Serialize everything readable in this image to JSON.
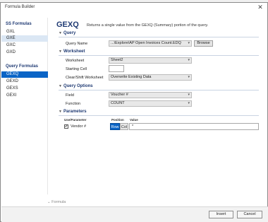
{
  "window": {
    "title": "Formula Builder",
    "close_glyph": "✕"
  },
  "sidebar": {
    "groups": [
      {
        "label": "SS Formulas",
        "items": [
          "GXL",
          "GXE",
          "GXC",
          "GXD"
        ]
      },
      {
        "label": "Query Formulas",
        "items": [
          "GEXQ",
          "GEXD",
          "GEXS",
          "GEXI"
        ]
      }
    ],
    "highlighted_item": "GXE",
    "selected_item": "GEXQ"
  },
  "header": {
    "function_name": "GEXQ",
    "description": "Returns a single value from the GEXQ (Summary) portion of the query."
  },
  "sections": {
    "query": {
      "title": "Query",
      "query_name_label": "Query Name",
      "query_name_value": "...\\Explore\\AP Open Invoices Count.EDQ",
      "browse_label": "Browse"
    },
    "worksheet": {
      "title": "Worksheet",
      "worksheet_label": "Worksheet",
      "worksheet_value": "Sheet2",
      "starting_cell_label": "Starting Cell",
      "starting_cell_value": "",
      "clear_shift_label": "Clear/Shift Worksheet",
      "clear_shift_value": "Overwrite Existing Data"
    },
    "query_options": {
      "title": "Query Options",
      "field_label": "Field",
      "field_value": "Voucher #",
      "function_label": "Function",
      "function_value": "COUNT"
    },
    "parameters": {
      "title": "Parameters",
      "col_use": "Use/Parameter",
      "col_position": "Position",
      "col_value": "Value",
      "rows": [
        {
          "checked_glyph": "✔",
          "name": "Vendor #",
          "row_label": "Row",
          "col_label": "Col",
          "value": "*"
        }
      ]
    }
  },
  "formula": {
    "label": "Formula"
  },
  "footer": {
    "insert_label": "Insert",
    "cancel_label": "Cancel"
  },
  "colors": {
    "accent": "#0a64c6",
    "heading": "#1f3a73",
    "highlight": "#dbe7f4"
  },
  "icons": {
    "collapse": "chevron-down-icon",
    "dropdown": "dropdown-arrow-icon",
    "close": "close-icon"
  }
}
